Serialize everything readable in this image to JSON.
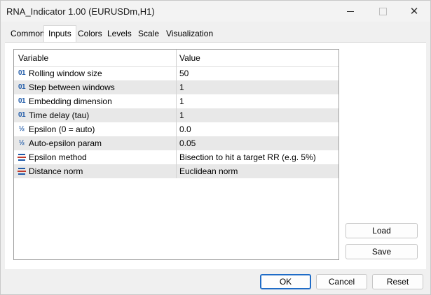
{
  "window": {
    "title": "RNA_Indicator 1.00 (EURUSDm,H1)",
    "minimize_glyph": "",
    "maximize_glyph": "",
    "close_glyph": "✕"
  },
  "tabs": [
    {
      "label": "Common",
      "active": false
    },
    {
      "label": "Inputs",
      "active": true
    },
    {
      "label": "Colors",
      "active": false
    },
    {
      "label": "Levels",
      "active": false
    },
    {
      "label": "Scale",
      "active": false
    },
    {
      "label": "Visualization",
      "active": false
    }
  ],
  "grid": {
    "columns": {
      "variable": "Variable",
      "value": "Value"
    },
    "rows": [
      {
        "icon": "integer-icon",
        "glyph": "01",
        "variable": "Rolling window size",
        "value": "50"
      },
      {
        "icon": "integer-icon",
        "glyph": "01",
        "variable": "Step between windows",
        "value": "1"
      },
      {
        "icon": "integer-icon",
        "glyph": "01",
        "variable": "Embedding dimension",
        "value": "1"
      },
      {
        "icon": "integer-icon",
        "glyph": "01",
        "variable": "Time delay (tau)",
        "value": "1"
      },
      {
        "icon": "double-icon",
        "glyph": "½",
        "variable": "Epsilon (0 = auto)",
        "value": "0.0"
      },
      {
        "icon": "double-icon",
        "glyph": "½",
        "variable": "Auto-epsilon param",
        "value": "0.05"
      },
      {
        "icon": "enum-icon",
        "glyph": "",
        "variable": "Epsilon method",
        "value": "Bisection to hit a target RR (e.g. 5%)"
      },
      {
        "icon": "enum-icon",
        "glyph": "",
        "variable": "Distance norm",
        "value": "Euclidean norm"
      }
    ]
  },
  "side_buttons": {
    "load": "Load",
    "save": "Save"
  },
  "footer_buttons": {
    "ok": "OK",
    "cancel": "Cancel",
    "reset": "Reset"
  },
  "colors": {
    "accent": "#1f6cc7",
    "icon": "#1f5aa8",
    "row_alt": "#e8e8e8"
  }
}
